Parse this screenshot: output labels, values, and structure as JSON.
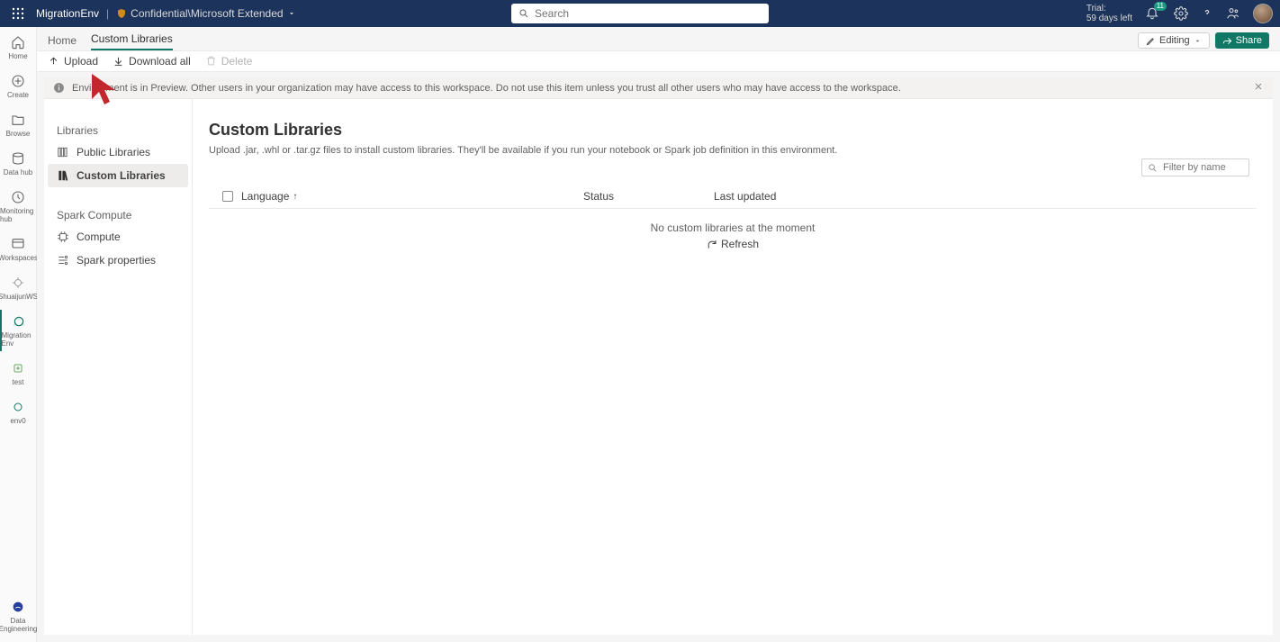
{
  "topbar": {
    "workspace": "MigrationEnv",
    "sensitivity": "Confidential\\Microsoft Extended",
    "search_placeholder": "Search",
    "trial_label": "Trial:",
    "trial_remaining": "59 days left",
    "notification_count": "11"
  },
  "rail": {
    "items": [
      {
        "label": "Home"
      },
      {
        "label": "Create"
      },
      {
        "label": "Browse"
      },
      {
        "label": "Data hub"
      },
      {
        "label": "Monitoring hub"
      },
      {
        "label": "Workspaces"
      },
      {
        "label": "ShuaijunWS"
      },
      {
        "label": "MigrationEnv"
      },
      {
        "label": "test"
      },
      {
        "label": "env0"
      }
    ],
    "footer": {
      "label": "Data Engineering"
    }
  },
  "crumbs": {
    "home": "Home",
    "current": "Custom Libraries"
  },
  "header_actions": {
    "editing": "Editing",
    "share": "Share"
  },
  "toolbar": {
    "upload": "Upload",
    "download_all": "Download all",
    "delete": "Delete"
  },
  "banner": {
    "text": "Environment is in Preview. Other users in your organization may have access to this workspace. Do not use this item unless you trust all other users who may have access to the workspace."
  },
  "sidenav": {
    "libraries_header": "Libraries",
    "public": "Public Libraries",
    "custom": "Custom Libraries",
    "spark_header": "Spark Compute",
    "compute": "Compute",
    "spark_props": "Spark properties"
  },
  "page": {
    "title": "Custom Libraries",
    "description": "Upload .jar, .whl or .tar.gz files to install custom libraries. They'll be available if you run your notebook or Spark job definition in this environment.",
    "filter_placeholder": "Filter by name",
    "columns": {
      "language": "Language",
      "status": "Status",
      "last_updated": "Last updated"
    },
    "empty_message": "No custom libraries at the moment",
    "refresh": "Refresh"
  }
}
